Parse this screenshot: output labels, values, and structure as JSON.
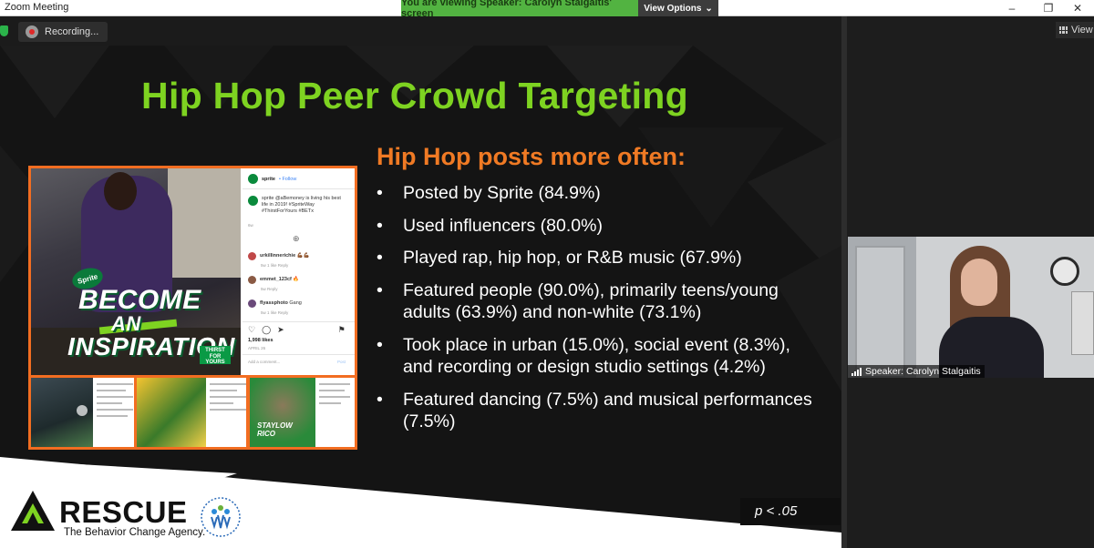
{
  "window": {
    "title": "Zoom Meeting"
  },
  "banner": {
    "message": "You are viewing Speaker: Carolyn Stalgaitis' screen",
    "view_options": "View Options"
  },
  "toolbar": {
    "recording": "Recording..."
  },
  "panel": {
    "view_label": "View",
    "speaker_label": "Speaker: Carolyn Stalgaitis"
  },
  "slide": {
    "title": "Hip Hop Peer Crowd Targeting",
    "subheading": "Hip Hop posts more often:",
    "bullets": [
      "Posted by Sprite (84.9%)",
      "Used influencers (80.0%)",
      "Played rap, hip hop, or R&B music (67.9%)",
      "Featured people (90.0%), primarily teens/young adults (63.9%) and non-white (73.1%)",
      "Took place in urban (15.0%), social event (8.3%), and recording or design studio settings (4.2%)",
      "Featured dancing (7.5%) and musical performances (7.5%)"
    ],
    "p_value": "p < .05",
    "logo": {
      "name": "RESCUE",
      "tagline": "The Behavior Change Agency.",
      "partner_text": "VIRGINIA FOUNDATION for HEALTHY YOUTH"
    },
    "post": {
      "promo_line1": "BECOME",
      "promo_line2": "AN",
      "promo_line3": "INSPIRATION",
      "badge": "Sprite",
      "thirst": "THIRST FOR YOURS",
      "account": "sprite",
      "follow": "• Follow",
      "caption": "sprite @aBemoney is living his best life in 2019! #SpriteWay #ThirstForYours #BETx",
      "comments": [
        {
          "user": "urkillinnerichie",
          "text": "💪🏾💪🏾",
          "meta": "5w  1 like  Reply"
        },
        {
          "user": "emmet_123cf",
          "text": "🔥",
          "meta": "5w  Reply"
        },
        {
          "user": "flyassphoto",
          "text": "Gang",
          "meta": "5w  1 like  Reply"
        }
      ],
      "likes": "1,998 likes",
      "date": "APRIL 26",
      "add_comment": "Add a comment...",
      "post_button": "Post",
      "thumb_caption": "STAYLOW RICO"
    }
  },
  "colors": {
    "title_green": "#7ed321",
    "orange": "#f07a24",
    "banner_green": "#52b341"
  }
}
